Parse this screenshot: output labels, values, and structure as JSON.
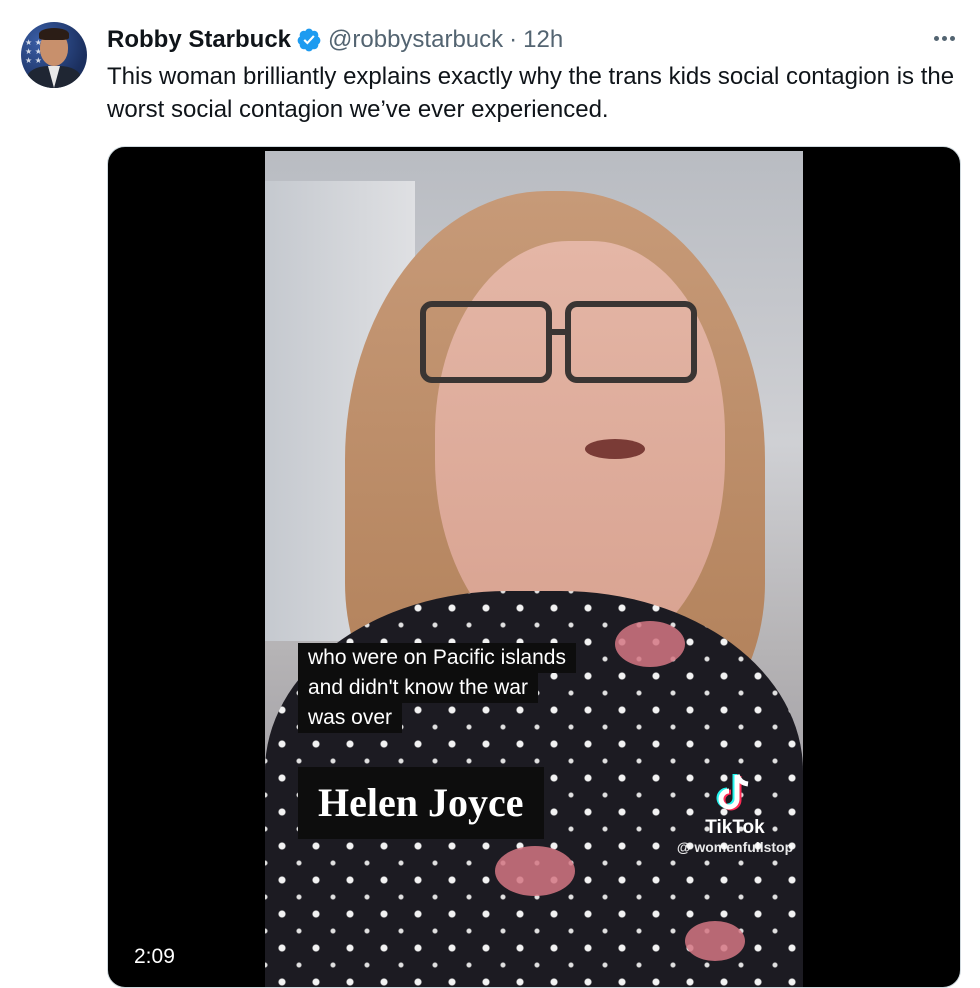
{
  "tweet": {
    "author_name": "Robby Starbuck",
    "handle": "@robbystarbuck",
    "separator": "·",
    "time": "12h",
    "text": "This woman brilliantly explains exactly why the trans kids social contagion is the worst social contagion we’ve ever experienced."
  },
  "media": {
    "caption_lines": [
      "who were on Pacific islands",
      "and didn't know the war",
      "was over"
    ],
    "name_overlay": "Helen Joyce",
    "tiktok_brand": "TikTok",
    "tiktok_handle": "@ womenfullstop",
    "duration": "2:09"
  },
  "icons": {
    "verified": "verified-badge-icon",
    "more": "more-options-icon",
    "tiktok": "tiktok-logo-icon"
  },
  "colors": {
    "verified_blue": "#1d9bf0",
    "secondary_text": "#536471",
    "primary_text": "#0f1419"
  }
}
